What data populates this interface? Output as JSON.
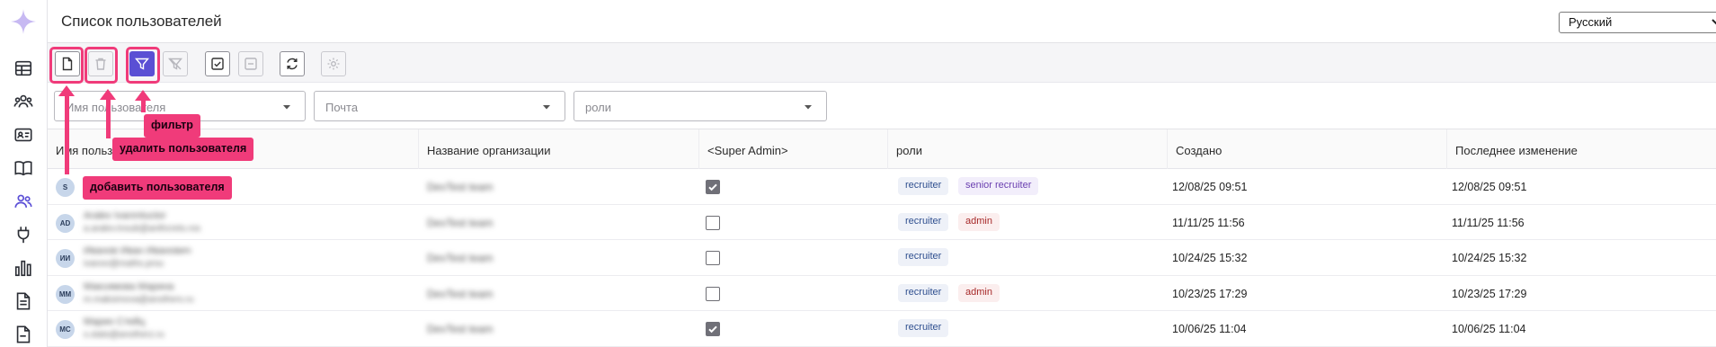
{
  "header": {
    "title": "Список пользователей",
    "language": "Русский"
  },
  "rail": {
    "items": [
      {
        "icon": "table-icon"
      },
      {
        "icon": "groups-icon"
      },
      {
        "icon": "id-card-icon"
      },
      {
        "icon": "book-icon"
      },
      {
        "icon": "users-icon",
        "active": true
      },
      {
        "icon": "plug-icon"
      },
      {
        "icon": "bar-chart-icon"
      },
      {
        "icon": "document-icon"
      },
      {
        "icon": "file-icon"
      }
    ]
  },
  "toolbar": {
    "buttons": [
      {
        "name": "add-user",
        "icon": "new-document-icon"
      },
      {
        "name": "delete-user",
        "icon": "trash-icon",
        "disabled": true
      },
      {
        "name": "filter",
        "icon": "filter-icon",
        "primary": true
      },
      {
        "name": "clear-filter",
        "icon": "filter-off-icon",
        "disabled": true
      },
      {
        "name": "select-all",
        "icon": "checkbox-checked-icon"
      },
      {
        "name": "deselect",
        "icon": "checkbox-minus-icon",
        "disabled": true
      },
      {
        "name": "refresh",
        "icon": "refresh-icon"
      },
      {
        "name": "settings",
        "icon": "gear-icon",
        "disabled": true
      }
    ]
  },
  "filters": {
    "username_placeholder": "Имя пользователя",
    "email_placeholder": "Почта",
    "roles_placeholder": "роли"
  },
  "table": {
    "columns": [
      "Имя пользователя",
      "Название организации",
      "<Super Admin>",
      "роли",
      "Создано",
      "Последнее изменение"
    ],
    "rows": [
      {
        "initials": "S",
        "name": "",
        "email": "",
        "org": "DevTest team",
        "super_admin": true,
        "roles": [
          "recruiter",
          "senior recruiter"
        ],
        "created": "12/08/25 09:51",
        "modified": "12/08/25 09:51"
      },
      {
        "initials": "AD",
        "name": "Aralev Ivanmtuctor",
        "email": "a.aralev.tnsub@anthcrets.ros",
        "org": "DevTest team",
        "super_admin": false,
        "roles": [
          "recruiter",
          "admin"
        ],
        "created": "11/11/25 11:56",
        "modified": "11/11/25 11:56"
      },
      {
        "initials": "ИИ",
        "name": "Иванов Иван Иванович",
        "email": "ivanov@maths.prou",
        "org": "DevTest team",
        "super_admin": false,
        "roles": [
          "recruiter"
        ],
        "created": "10/24/25 15:32",
        "modified": "10/24/25 15:32"
      },
      {
        "initials": "ММ",
        "name": "Максимова Марина",
        "email": "m.maksimova@anothers.ru",
        "org": "DevTest team",
        "super_admin": false,
        "roles": [
          "recruiter",
          "admin"
        ],
        "created": "10/23/25 17:29",
        "modified": "10/23/25 17:29"
      },
      {
        "initials": "МС",
        "name": "Марин Стейц",
        "email": "s.stats@anotherz.ru",
        "org": "DevTest team",
        "super_admin": true,
        "roles": [
          "recruiter"
        ],
        "created": "10/06/25 11:04",
        "modified": "10/06/25 11:04"
      }
    ]
  },
  "annotations": {
    "filter": "фильтр",
    "delete_user": "удалить пользователя",
    "add_user": "добавить пользователя",
    "color": "#f03b7a"
  }
}
